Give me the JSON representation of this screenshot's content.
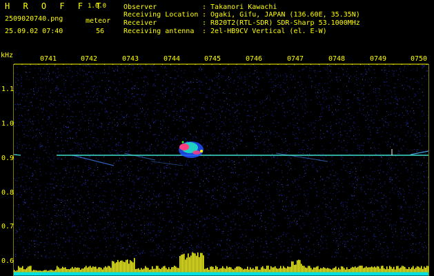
{
  "header": {
    "app_name": "H R O F F T",
    "version": "1.0.0",
    "filename": "2509020740.png",
    "datetime": "25.09.02 07:40",
    "meteor_label": "meteor",
    "meteor_count": "56",
    "info": [
      {
        "label": "Observer",
        "value": ": Takanori Kawachi"
      },
      {
        "label": "Receiving Location",
        "value": ": Ogaki, Gifu, JAPAN (136.60E, 35.35N)"
      },
      {
        "label": "Receiver",
        "value": ": R820T2(RTL-SDR) SDR-Sharp 53.1000MHz"
      },
      {
        "label": "Receiving antenna",
        "value": ": 2el-HB9CV Vertical (el. E-W)"
      }
    ]
  },
  "axes": {
    "y_unit": "kHz",
    "x_ticks": [
      "0741",
      "0742",
      "0743",
      "0744",
      "0745",
      "0746",
      "0747",
      "0748",
      "0749",
      "0750"
    ],
    "y_ticks": [
      "1.1",
      "1.0",
      "0.9",
      "0.8",
      "0.7",
      "0.6"
    ]
  },
  "colors": {
    "text": "#ffff00",
    "background": "#000000",
    "noise": "#1a24a0",
    "carrier": "#40e0d0",
    "meteor_hot": "#ff4080",
    "signal_bars": "#ffff00",
    "signal_floor": "#00e0e0"
  }
}
